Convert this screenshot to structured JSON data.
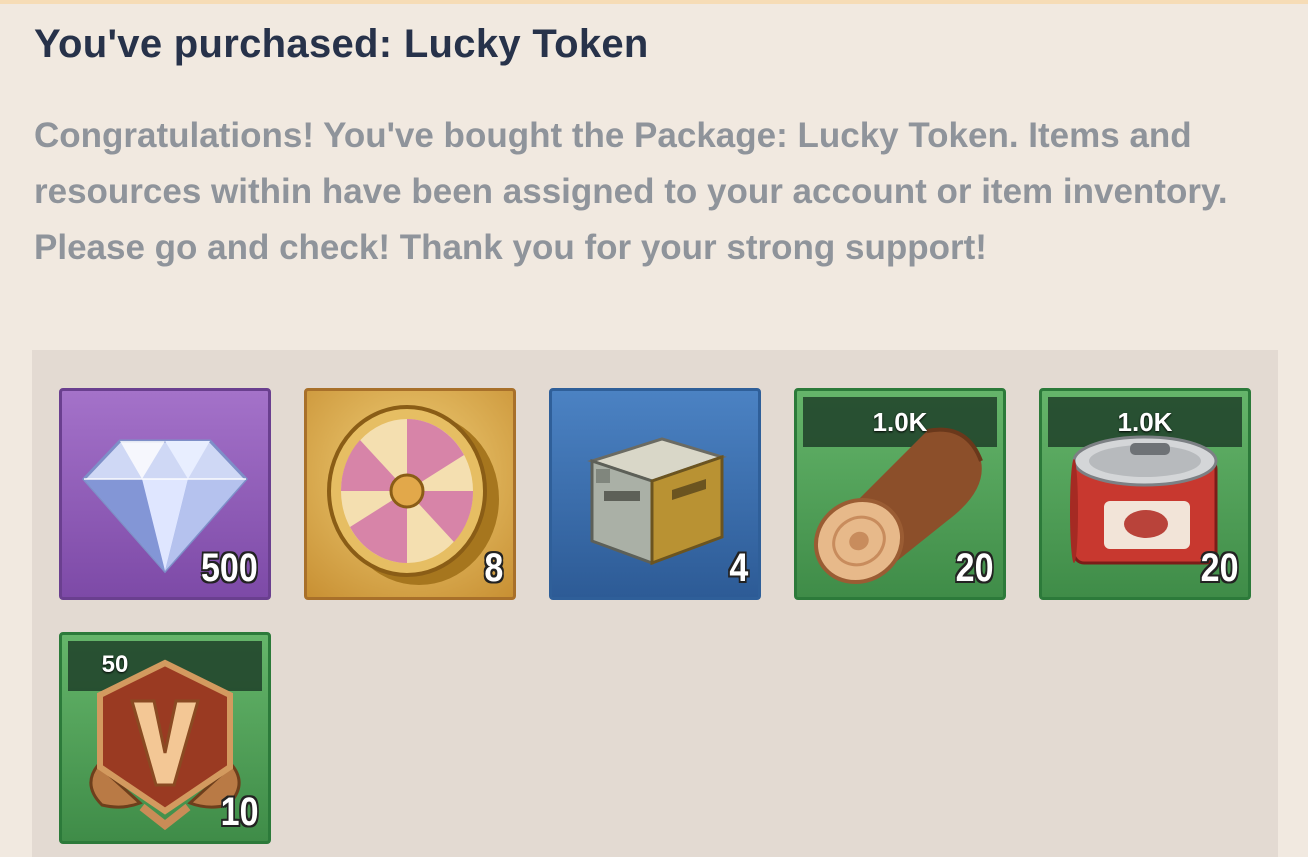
{
  "dialog": {
    "title": "You've purchased: Lucky Token",
    "message": "Congratulations! You've bought the Package: Lucky Token. Items and resources within have been assigned to your account or item inventory. Please go and check! Thank you for your strong support!"
  },
  "rewards": [
    {
      "icon": "diamond-icon",
      "count": "500",
      "frame": "purple",
      "label": ""
    },
    {
      "icon": "lucky-wheel-token-icon",
      "count": "8",
      "frame": "gold",
      "label": ""
    },
    {
      "icon": "supply-crate-icon",
      "count": "4",
      "frame": "blue",
      "label": ""
    },
    {
      "icon": "wood-log-icon",
      "count": "20",
      "frame": "green",
      "label": "1.0K"
    },
    {
      "icon": "food-can-icon",
      "count": "20",
      "frame": "green",
      "label": "1.0K"
    },
    {
      "icon": "vip-points-badge-icon",
      "count": "10",
      "frame": "green",
      "label": "50"
    }
  ],
  "colors": {
    "background": "#f1e9e0",
    "title": "#27324a",
    "message": "#8f949b",
    "reward_panel": "#e3dad2",
    "frame_purple": "#7d4aa7",
    "frame_gold": "#c89033",
    "frame_blue": "#2d5b96",
    "frame_green": "#3f8c48"
  }
}
